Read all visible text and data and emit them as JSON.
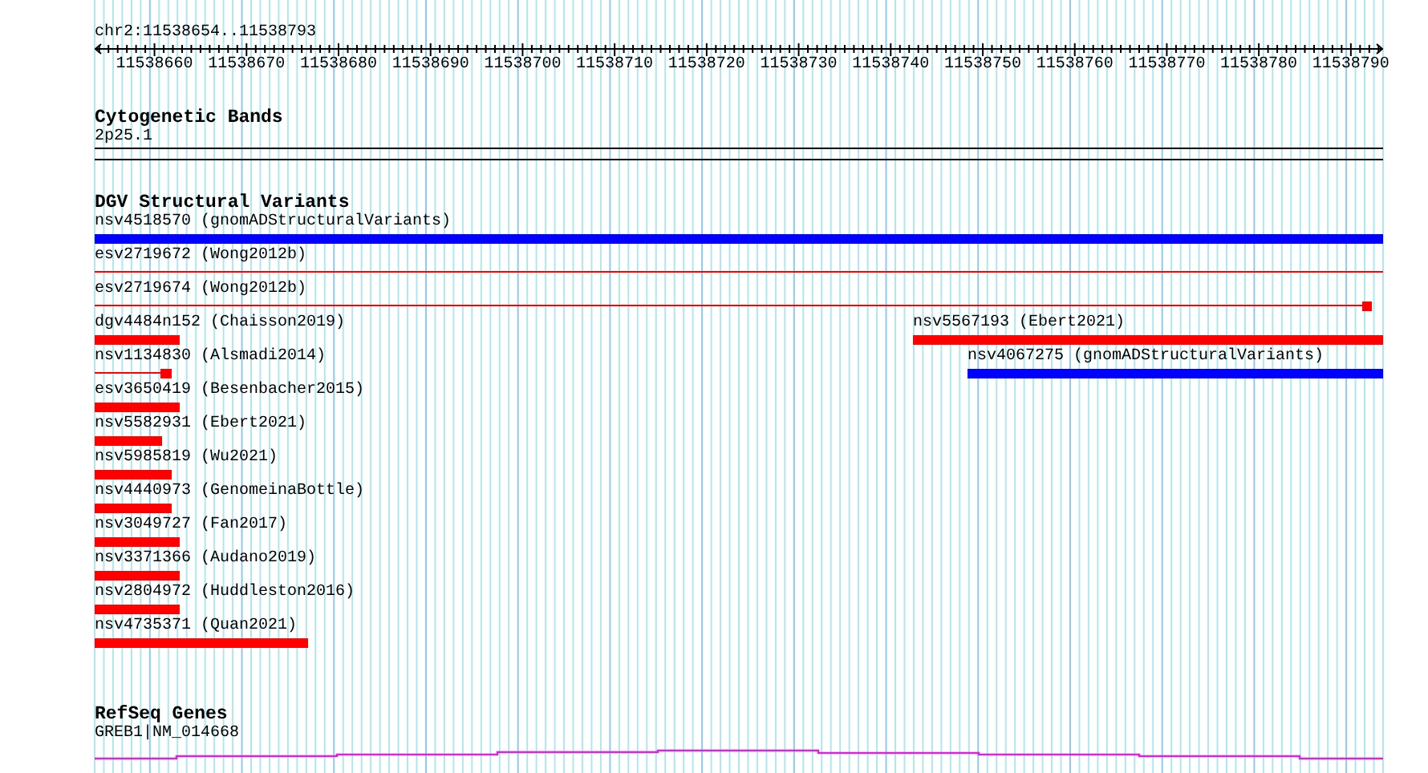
{
  "position": "chr2:11538654..11538793",
  "ruler": {
    "ticks": [
      "11538660",
      "11538670",
      "11538680",
      "11538690",
      "11538700",
      "11538710",
      "11538720",
      "11538730",
      "11538740",
      "11538750",
      "11538760",
      "11538770",
      "11538780",
      "11538790"
    ]
  },
  "cytogenetic_bands": {
    "title": "Cytogenetic Bands",
    "band": "2p25.1"
  },
  "dgv": {
    "title": "DGV Structural Variants",
    "rows": [
      {
        "features": [
          {
            "label": "nsv4518570 (gnomADStructuralVariants)",
            "color": "#0000ff",
            "kind": "bar"
          }
        ]
      },
      {
        "features": [
          {
            "label": "esv2719672 (Wong2012b)",
            "color": "#ff0000",
            "kind": "line"
          }
        ]
      },
      {
        "features": [
          {
            "label": "esv2719674 (Wong2012b)",
            "color": "#ff0000",
            "kind": "line"
          }
        ]
      },
      {
        "features": [
          {
            "label": "dgv4484n152 (Chaisson2019)",
            "color": "#ff0000",
            "kind": "bar"
          },
          {
            "label": "nsv5567193 (Ebert2021)",
            "color": "#ff0000",
            "kind": "bar"
          }
        ]
      },
      {
        "features": [
          {
            "label": "nsv1134830 (Alsmadi2014)",
            "color": "#ff0000",
            "kind": "line"
          },
          {
            "label": "nsv4067275 (gnomADStructuralVariants)",
            "color": "#0000ff",
            "kind": "bar"
          }
        ]
      },
      {
        "features": [
          {
            "label": "esv3650419 (Besenbacher2015)",
            "color": "#ff0000",
            "kind": "bar"
          }
        ]
      },
      {
        "features": [
          {
            "label": "nsv5582931 (Ebert2021)",
            "color": "#ff0000",
            "kind": "bar"
          }
        ]
      },
      {
        "features": [
          {
            "label": "nsv5985819 (Wu2021)",
            "color": "#ff0000",
            "kind": "bar"
          }
        ]
      },
      {
        "features": [
          {
            "label": "nsv4440973 (GenomeinaBottle)",
            "color": "#ff0000",
            "kind": "bar"
          }
        ]
      },
      {
        "features": [
          {
            "label": "nsv3049727 (Fan2017)",
            "color": "#ff0000",
            "kind": "bar"
          }
        ]
      },
      {
        "features": [
          {
            "label": "nsv3371366 (Audano2019)",
            "color": "#ff0000",
            "kind": "bar"
          }
        ]
      },
      {
        "features": [
          {
            "label": "nsv2804972 (Huddleston2016)",
            "color": "#ff0000",
            "kind": "bar"
          }
        ]
      },
      {
        "features": [
          {
            "label": "nsv4735371 (Quan2021)",
            "color": "#ff0000",
            "kind": "bar"
          }
        ]
      }
    ]
  },
  "refseq_genes": {
    "title": "RefSeq Genes",
    "gene": "GREB1|NM_014668"
  }
}
